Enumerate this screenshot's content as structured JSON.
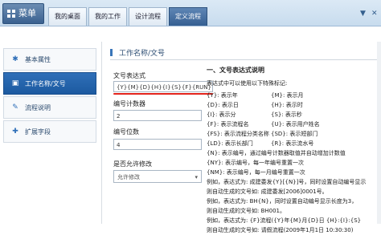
{
  "header": {
    "menu_label": "菜单",
    "tabs": [
      "我的桌面",
      "我的工作",
      "设计流程",
      "定义流程"
    ],
    "active_tab": 3,
    "controls": [
      "▼",
      "✕"
    ]
  },
  "sidebar": {
    "items": [
      {
        "label": "基本属性",
        "icon": "✱"
      },
      {
        "label": "工作名称/文号",
        "icon": "▣"
      },
      {
        "label": "流程说明",
        "icon": "✎"
      },
      {
        "label": "扩展字段",
        "icon": "✚"
      }
    ],
    "active_index": 1
  },
  "section": {
    "title": "工作名称/文号"
  },
  "form": {
    "expr_label": "文号表达式",
    "expr_value": "{Y}{M}{D}{H}{I}{S}{F}{RUN}{NO}",
    "counter_label": "编号计数器",
    "counter_value": "2",
    "digits_label": "编号位数",
    "digits_value": "4",
    "allow_edit_label": "是否允许修改",
    "allow_edit_value": "允许修改"
  },
  "help": {
    "title": "一、文号表达式说明",
    "subtitle": "表达式中可以使用以下特殊标记:",
    "pairs": [
      [
        "{Y}: 表示年",
        "{M}: 表示月"
      ],
      [
        "{D}: 表示日",
        "{H}: 表示时"
      ],
      [
        "{I}: 表示分",
        "{S}: 表示秒"
      ],
      [
        "{F}: 表示流程名",
        "{U}: 表示用户姓名"
      ],
      [
        "{FS}: 表示流程分类名称",
        "{SD}: 表示短部门"
      ],
      [
        "{LD}: 表示长部门",
        "{R}: 表示流水号"
      ]
    ],
    "lines": [
      "{N}: 表示编号，通过编号计数器取值并自动增加计数值",
      "{NY}: 表示编号，每一年编号重置一次",
      "{NM}: 表示编号，每一月编号重置一次",
      "例如，表达式为: 成建委发{Y}[{N}]号，同时设置自动编号显示",
      "则自动生成的文号如: 成建委发[2006]0001号。",
      "例如，表达式为: BH{N}，同时设置自动编号显示长度为3，",
      "则自动生成的文号如: BH001。",
      "例如，表达式为: {F}流程({Y}年{M}月{D}日 {H}:{I}:{S}",
      "则自动生成的文号如: 请假流程(2009年1月1日 10:30:30)"
    ]
  }
}
